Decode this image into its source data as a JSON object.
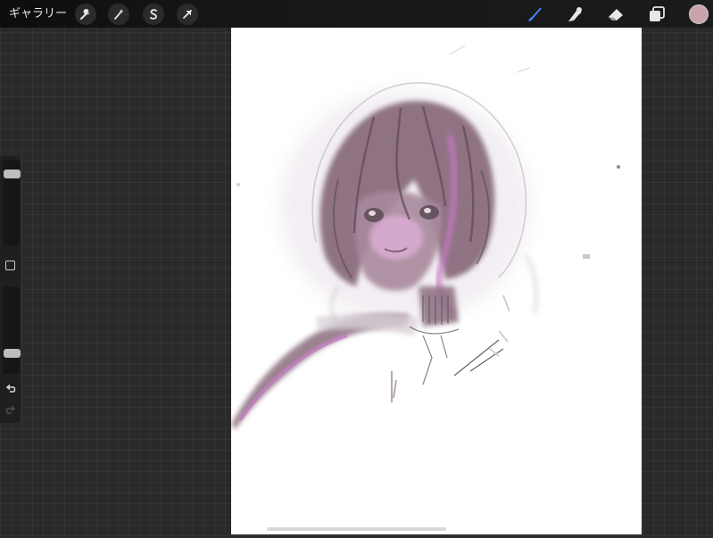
{
  "toolbar": {
    "gallery_label": "ギャラリー",
    "left_tools": [
      {
        "icon": "wrench-icon",
        "name": "actions"
      },
      {
        "icon": "magic-wand-icon",
        "name": "adjustments"
      },
      {
        "icon": "selection-s-icon",
        "name": "selection"
      },
      {
        "icon": "arrow-cursor-icon",
        "name": "transform"
      }
    ],
    "right_tools": [
      {
        "icon": "brush-icon",
        "name": "paint",
        "active": true
      },
      {
        "icon": "smudge-icon",
        "name": "smudge",
        "active": false
      },
      {
        "icon": "eraser-icon",
        "name": "erase",
        "active": false
      },
      {
        "icon": "layers-icon",
        "name": "layers",
        "active": false
      }
    ],
    "current_color": "#c9a3ab",
    "active_tool_color": "#3d84ff"
  },
  "sidebar": {
    "brush_size_level": 0.88,
    "brush_opacity_level": 0.2,
    "modify_icon": "square-modify-icon",
    "undo_icon": "undo-icon",
    "redo_icon": "redo-icon",
    "redo_enabled": false
  },
  "canvas": {
    "background": "#ffffff",
    "artwork_palette": [
      "#8a6d7e",
      "#c47ac2",
      "#5b4a55",
      "#e6b3e0"
    ]
  }
}
